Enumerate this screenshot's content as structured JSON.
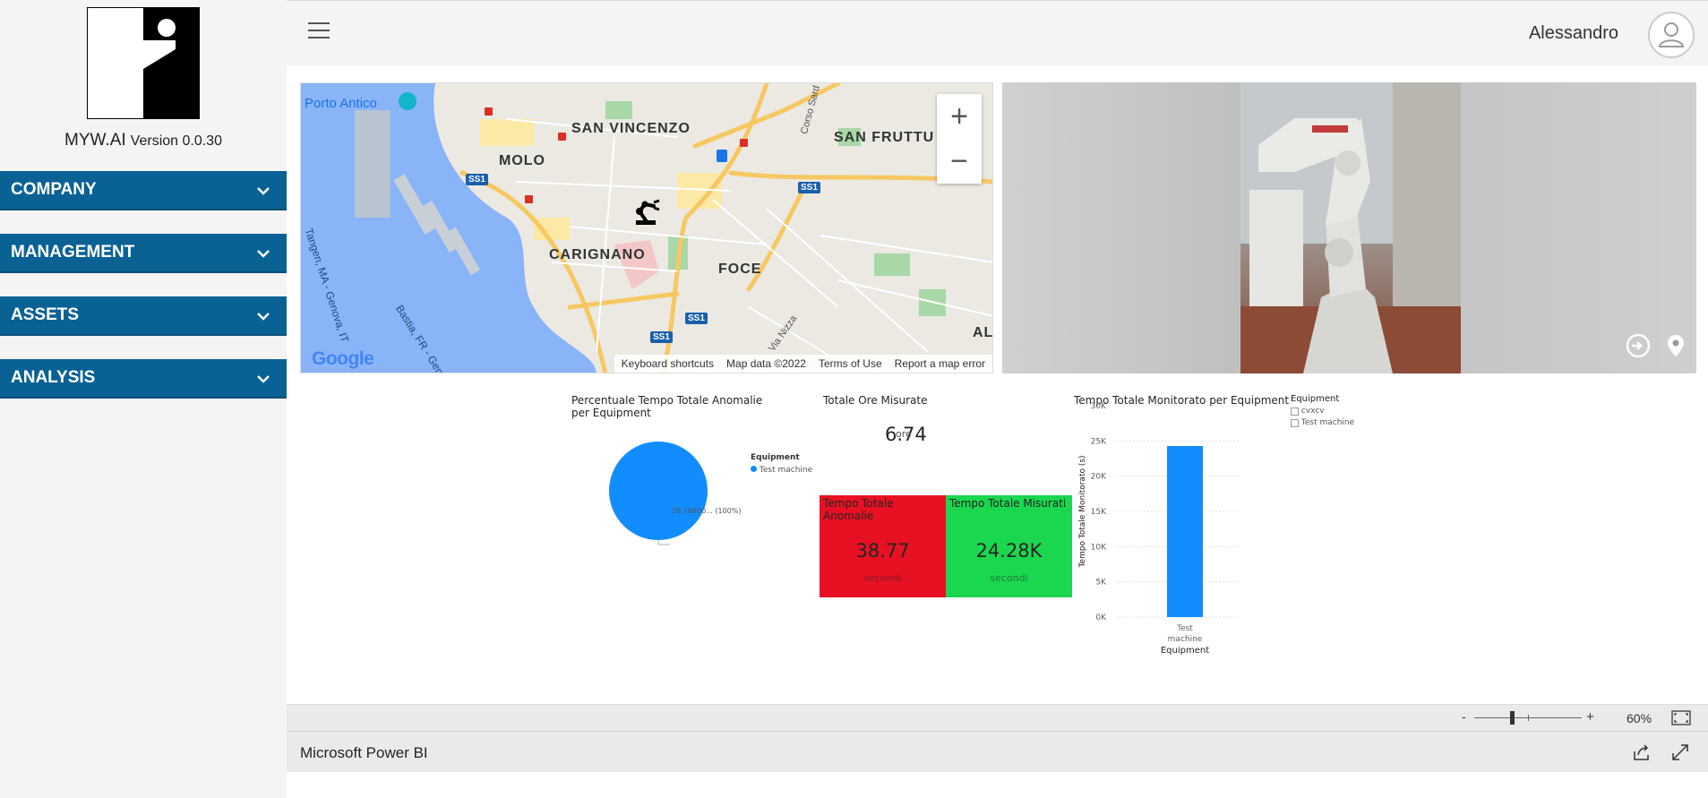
{
  "sidebar": {
    "brand": "MYW.AI",
    "version": "Version 0.0.30",
    "items": [
      {
        "label": "COMPANY"
      },
      {
        "label": "MANAGEMENT"
      },
      {
        "label": "ASSETS"
      },
      {
        "label": "ANALYSIS"
      }
    ]
  },
  "topbar": {
    "username": "Alessandro",
    "menu_icon": "hamburger-icon",
    "avatar_icon": "user-avatar-icon"
  },
  "map": {
    "labels": {
      "porto_antico": "Porto Antico",
      "san_vincenzo": "SAN VINCENZO",
      "san_fruttuoso": "SAN FRUTTU",
      "molo": "MOLO",
      "carignano": "CARIGNANO",
      "foce": "FOCE",
      "al": "AL",
      "tangenziale": "Tangen, MA - Genova, IT",
      "bastia": "Bastia, FR - Genov",
      "via_nizza": "Via Nizza",
      "corso": "Corso Sard",
      "ss1": "SS1"
    },
    "logo": "Google",
    "footer": {
      "keyboard": "Keyboard shortcuts",
      "mapdata": "Map data ©2022",
      "terms": "Terms of Use",
      "report": "Report a map error"
    },
    "zoom_in": "+",
    "zoom_out": "−",
    "marker_icon": "robot-arm-marker-icon"
  },
  "photo": {
    "icons": [
      "login-icon",
      "location-pin-icon"
    ]
  },
  "report": {
    "pie": {
      "title": "Percentuale Tempo Totale Anomalie per Equipment",
      "legend_title": "Equipment",
      "legend_item": "Test machine",
      "data_label": "38.76800... (100%)",
      "color": "#118DFF"
    },
    "card_hours": {
      "title": "Totale Ore Misurate",
      "value": "6.74",
      "unit": "ore"
    },
    "card_anomalies": {
      "title": "Tempo Totale Anomalie",
      "value": "38.77",
      "unit": "secondi",
      "color": "#E81123"
    },
    "card_measured": {
      "title": "Tempo Totale Misurati",
      "value": "24.28K",
      "unit": "secondi",
      "color": "#1AD74F"
    },
    "bar": {
      "title": "Tempo Totale Monitorato per Equipment",
      "y_label": "Tempo Totale Monitorato (s)",
      "x_label": "Equipment",
      "category_label_lines": [
        "Test",
        "machine"
      ],
      "ticks": [
        "30K",
        "25K",
        "20K",
        "15K",
        "10K",
        "5K",
        "0K"
      ]
    },
    "slicer": {
      "title": "Equipment",
      "options": [
        "cvxcv",
        "Test machine"
      ]
    }
  },
  "chart_data": {
    "type": "bar",
    "title": "Tempo Totale Monitorato per Equipment",
    "categories": [
      "Test machine"
    ],
    "values": [
      24280
    ],
    "xlabel": "Equipment",
    "ylabel": "Tempo Totale Monitorato (s)",
    "ylim": [
      0,
      30000
    ],
    "yticks": [
      0,
      5000,
      10000,
      15000,
      20000,
      25000,
      30000
    ],
    "grid": true,
    "color": "#118DFF"
  },
  "pbi": {
    "zoom_minus": "-",
    "zoom_plus": "+",
    "zoom_level": "60%",
    "zoom_fraction": 0.33,
    "brand": "Microsoft Power BI",
    "fit_icon": "fit-to-page-icon",
    "share_icon": "share-icon",
    "expand_icon": "expand-icon"
  }
}
